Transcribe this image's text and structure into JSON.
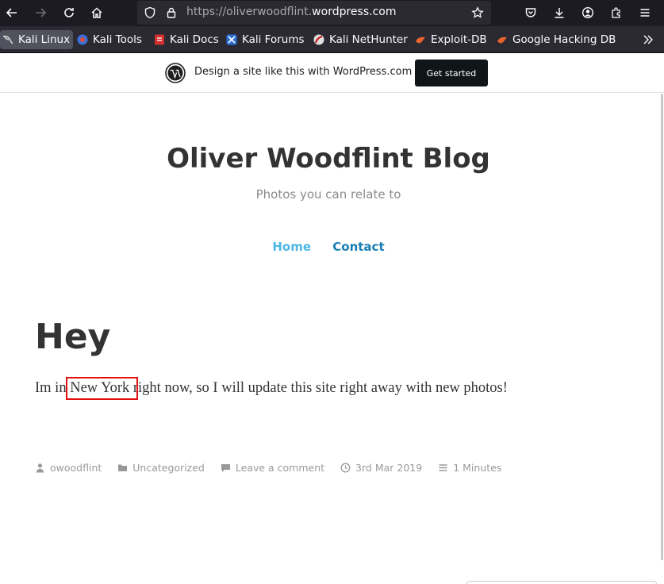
{
  "browser": {
    "url_dim": "https://oliverwoodflint.",
    "url_main": "wordpress.com",
    "bookmarks": [
      {
        "label": "Kali Linux",
        "icon": "kali-dragon-icon",
        "active": true
      },
      {
        "label": "Kali Tools",
        "icon": "kali-tools-icon"
      },
      {
        "label": "Kali Docs",
        "icon": "kali-docs-icon"
      },
      {
        "label": "Kali Forums",
        "icon": "kali-forums-icon"
      },
      {
        "label": "Kali NetHunter",
        "icon": "kali-nethunter-icon"
      },
      {
        "label": "Exploit-DB",
        "icon": "exploit-db-icon"
      },
      {
        "label": "Google Hacking DB",
        "icon": "ghdb-icon"
      }
    ]
  },
  "wpbanner": {
    "text": "Design a site like this with WordPress.com",
    "button": "Get started"
  },
  "site": {
    "title": "Oliver Woodflint Blog",
    "description": "Photos you can relate to",
    "nav": {
      "home": "Home",
      "contact": "Contact"
    }
  },
  "post": {
    "title": "Hey",
    "body_before": "Im in ",
    "body_highlight": "New York",
    "body_after": " right now, so I will update this site right away with new photos!",
    "meta": {
      "author": "owoodflint",
      "category": "Uncategorized",
      "comments": "Leave a comment",
      "date": "3rd Mar 2019",
      "reading_time": "1 Minutes"
    }
  }
}
